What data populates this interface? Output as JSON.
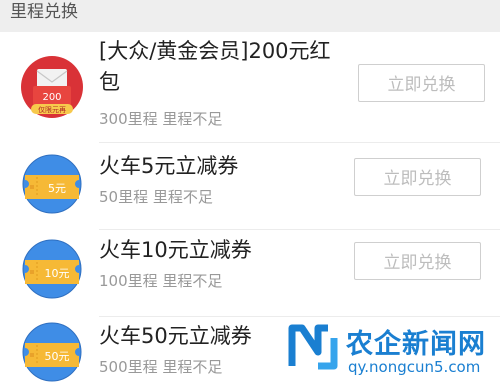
{
  "header": {
    "title": "里程兑换"
  },
  "items": [
    {
      "title": "[大众/黄金会员]200元红包",
      "subtitle": "300里程 里程不足",
      "button_label": "立即兑换",
      "icon": "red-packet-icon",
      "icon_value": "200",
      "icon_tag": "仅限元再"
    },
    {
      "title": "火车5元立减券",
      "subtitle": "50里程 里程不足",
      "button_label": "立即兑换",
      "icon": "coupon-ticket-icon",
      "icon_value": "5元"
    },
    {
      "title": "火车10元立减券",
      "subtitle": "100里程 里程不足",
      "button_label": "立即兑换",
      "icon": "coupon-ticket-icon",
      "icon_value": "10元"
    },
    {
      "title": "火车50元立减券",
      "subtitle": "500里程 里程不足",
      "button_label": "立即兑换",
      "icon": "coupon-ticket-icon",
      "icon_value": "50元"
    }
  ],
  "watermark": {
    "name": "农企新闻网",
    "url": "qy.nongcun5.com"
  },
  "colors": {
    "coupon_blue": "#3f8de6",
    "coupon_yellow": "#f6b936",
    "packet_red": "#d93237",
    "watermark_blue": "#1a7fd1"
  }
}
